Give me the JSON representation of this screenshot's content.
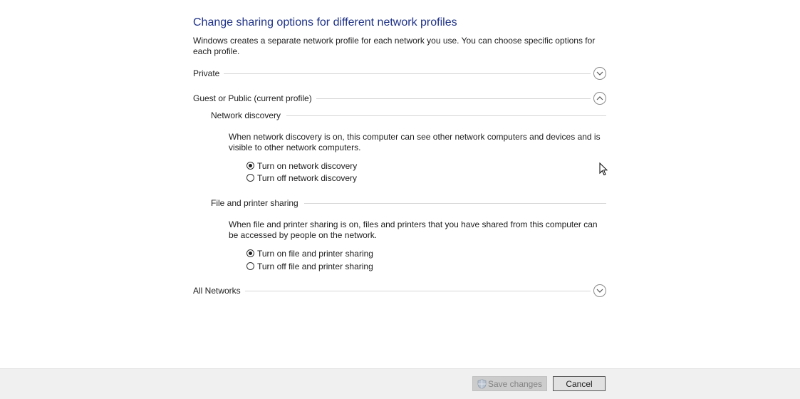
{
  "page": {
    "title": "Change sharing options for different network profiles",
    "intro": "Windows creates a separate network profile for each network you use. You can choose specific options for each profile."
  },
  "profiles": {
    "private": {
      "label": "Private",
      "expanded": false,
      "icon": "chevron-down-icon"
    },
    "guest_public": {
      "label": "Guest or Public (current profile)",
      "expanded": true,
      "icon": "chevron-up-icon",
      "network_discovery": {
        "heading": "Network discovery",
        "description": "When network discovery is on, this computer can see other network computers and devices and is visible to other network computers.",
        "options": [
          {
            "label": "Turn on network discovery",
            "selected": true
          },
          {
            "label": "Turn off network discovery",
            "selected": false
          }
        ]
      },
      "file_printer_sharing": {
        "heading": "File and printer sharing",
        "description": "When file and printer sharing is on, files and printers that you have shared from this computer can be accessed by people on the network.",
        "options": [
          {
            "label": "Turn on file and printer sharing",
            "selected": true
          },
          {
            "label": "Turn off file and printer sharing",
            "selected": false
          }
        ]
      }
    },
    "all_networks": {
      "label": "All Networks",
      "expanded": false,
      "icon": "chevron-down-icon"
    }
  },
  "footer": {
    "save_label": "Save changes",
    "save_icon": "uac-shield-icon",
    "save_enabled": false,
    "cancel_label": "Cancel"
  },
  "colors": {
    "title": "#1e3287",
    "footer_bg": "#f0f0f0",
    "divider": "#d6d6d6"
  }
}
